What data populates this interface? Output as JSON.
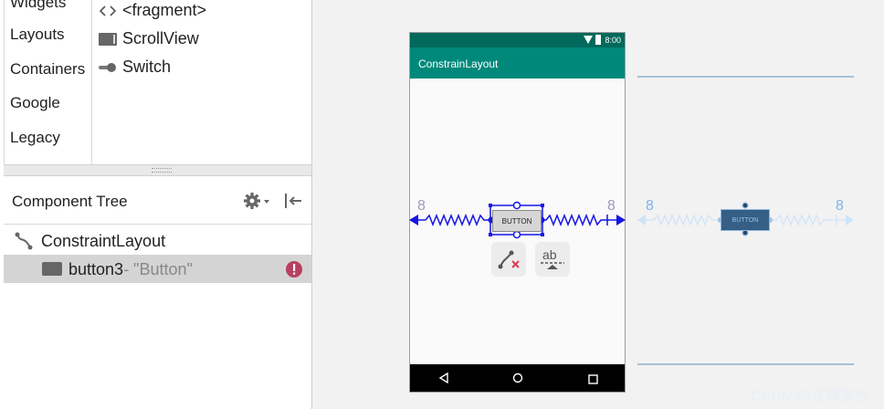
{
  "palette": {
    "categories": [
      "Widgets",
      "Layouts",
      "Containers",
      "Google",
      "Legacy"
    ],
    "items": [
      {
        "label": "<fragment>",
        "icon": "fragment-icon"
      },
      {
        "label": "ScrollView",
        "icon": "scrollview-icon"
      },
      {
        "label": "Switch",
        "icon": "switch-icon"
      }
    ]
  },
  "component_tree": {
    "title": "Component Tree",
    "root": "ConstraintLayout",
    "child_name": "button3",
    "child_sub": "- \"Button\""
  },
  "design": {
    "app_title": "ConstrainLayout",
    "status_time": "8:00",
    "button_label": "BUTTON",
    "margin_left": "8",
    "margin_right": "8"
  },
  "blueprint": {
    "button_label": "BUTTON",
    "margin_left": "8",
    "margin_right": "8"
  },
  "watermark": "CSDN @东隅者也",
  "colors": {
    "constraint_blue": "#1515e6",
    "blueprint_bg": "#234a6d",
    "error_red": "#b8405e",
    "appbar": "#00897b"
  }
}
